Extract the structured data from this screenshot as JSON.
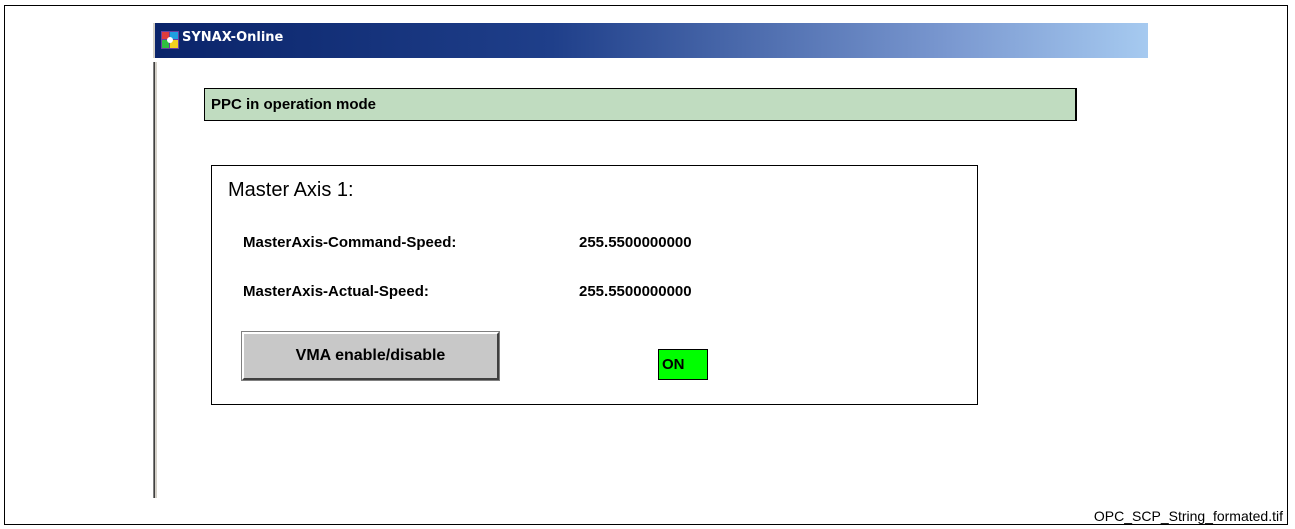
{
  "window": {
    "title": "SYNAX-Online",
    "app_icon": "synax-app-icon"
  },
  "status": {
    "text": "PPC in operation mode",
    "color": "#c0dcc0"
  },
  "master_axis": {
    "title": "Master Axis 1:",
    "rows": [
      {
        "label": "MasterAxis-Command-Speed:",
        "value": "255.5500000000"
      },
      {
        "label": "MasterAxis-Actual-Speed:",
        "value": "255.5500000000"
      }
    ],
    "button_label": "VMA enable/disable",
    "indicator_text": "ON",
    "indicator_color": "#00ff00"
  },
  "caption": "OPC_SCP_String_formated.tif"
}
